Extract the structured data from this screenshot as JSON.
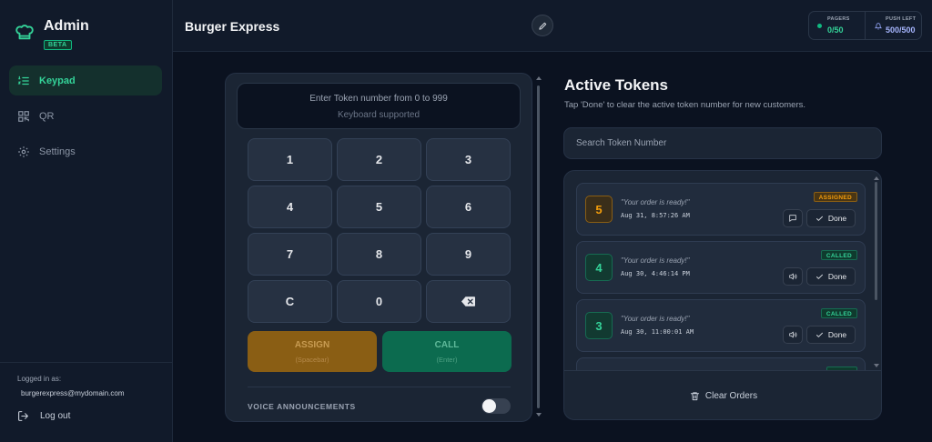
{
  "sidebar": {
    "brand": {
      "title": "Admin",
      "badge": "BETA"
    },
    "nav": [
      {
        "label": "Keypad",
        "icon": "list-number-icon",
        "active": true
      },
      {
        "label": "QR",
        "icon": "qr-code-icon",
        "active": false
      },
      {
        "label": "Settings",
        "icon": "gear-icon",
        "active": false
      }
    ],
    "footer": {
      "logged_in_label": "Logged in as:",
      "email": "burgerexpress@mydomain.com",
      "logout_label": "Log out"
    }
  },
  "header": {
    "title": "Burger Express",
    "stats": {
      "pagers_label": "PAGERS",
      "pagers_value": "0/50",
      "push_label": "PUSH LEFT",
      "push_value": "500/500"
    }
  },
  "keypad": {
    "prompt": "Enter Token number from 0 to 999",
    "hint": "Keyboard supported",
    "keys": [
      "1",
      "2",
      "3",
      "4",
      "5",
      "6",
      "7",
      "8",
      "9",
      "C",
      "0"
    ],
    "assign_label": "ASSIGN",
    "assign_hint": "(Spacebar)",
    "call_label": "CALL",
    "call_hint": "(Enter)",
    "voice_label": "VOICE ANNOUNCEMENTS",
    "voice_enabled": false
  },
  "tokens": {
    "title": "Active Tokens",
    "subtitle": "Tap 'Done' to clear the active token number for new customers.",
    "search_placeholder": "Search Token Number",
    "items": [
      {
        "number": "5",
        "status": "ASSIGNED",
        "message": "\"Your order is ready!\"",
        "time": "Aug 31, 8:57:26 AM",
        "action_icon": "message-icon",
        "done_label": "Done"
      },
      {
        "number": "4",
        "status": "CALLED",
        "message": "\"Your order is ready!\"",
        "time": "Aug 30, 4:46:14 PM",
        "action_icon": "speaker-icon",
        "done_label": "Done"
      },
      {
        "number": "3",
        "status": "CALLED",
        "message": "\"Your order is ready!\"",
        "time": "Aug 30, 11:00:01 AM",
        "action_icon": "speaker-icon",
        "done_label": "Done"
      }
    ],
    "clear_label": "Clear Orders"
  },
  "colors": {
    "accent_green": "#34d399",
    "assign_amber": "#f59e0b",
    "background": "#0b1220"
  }
}
